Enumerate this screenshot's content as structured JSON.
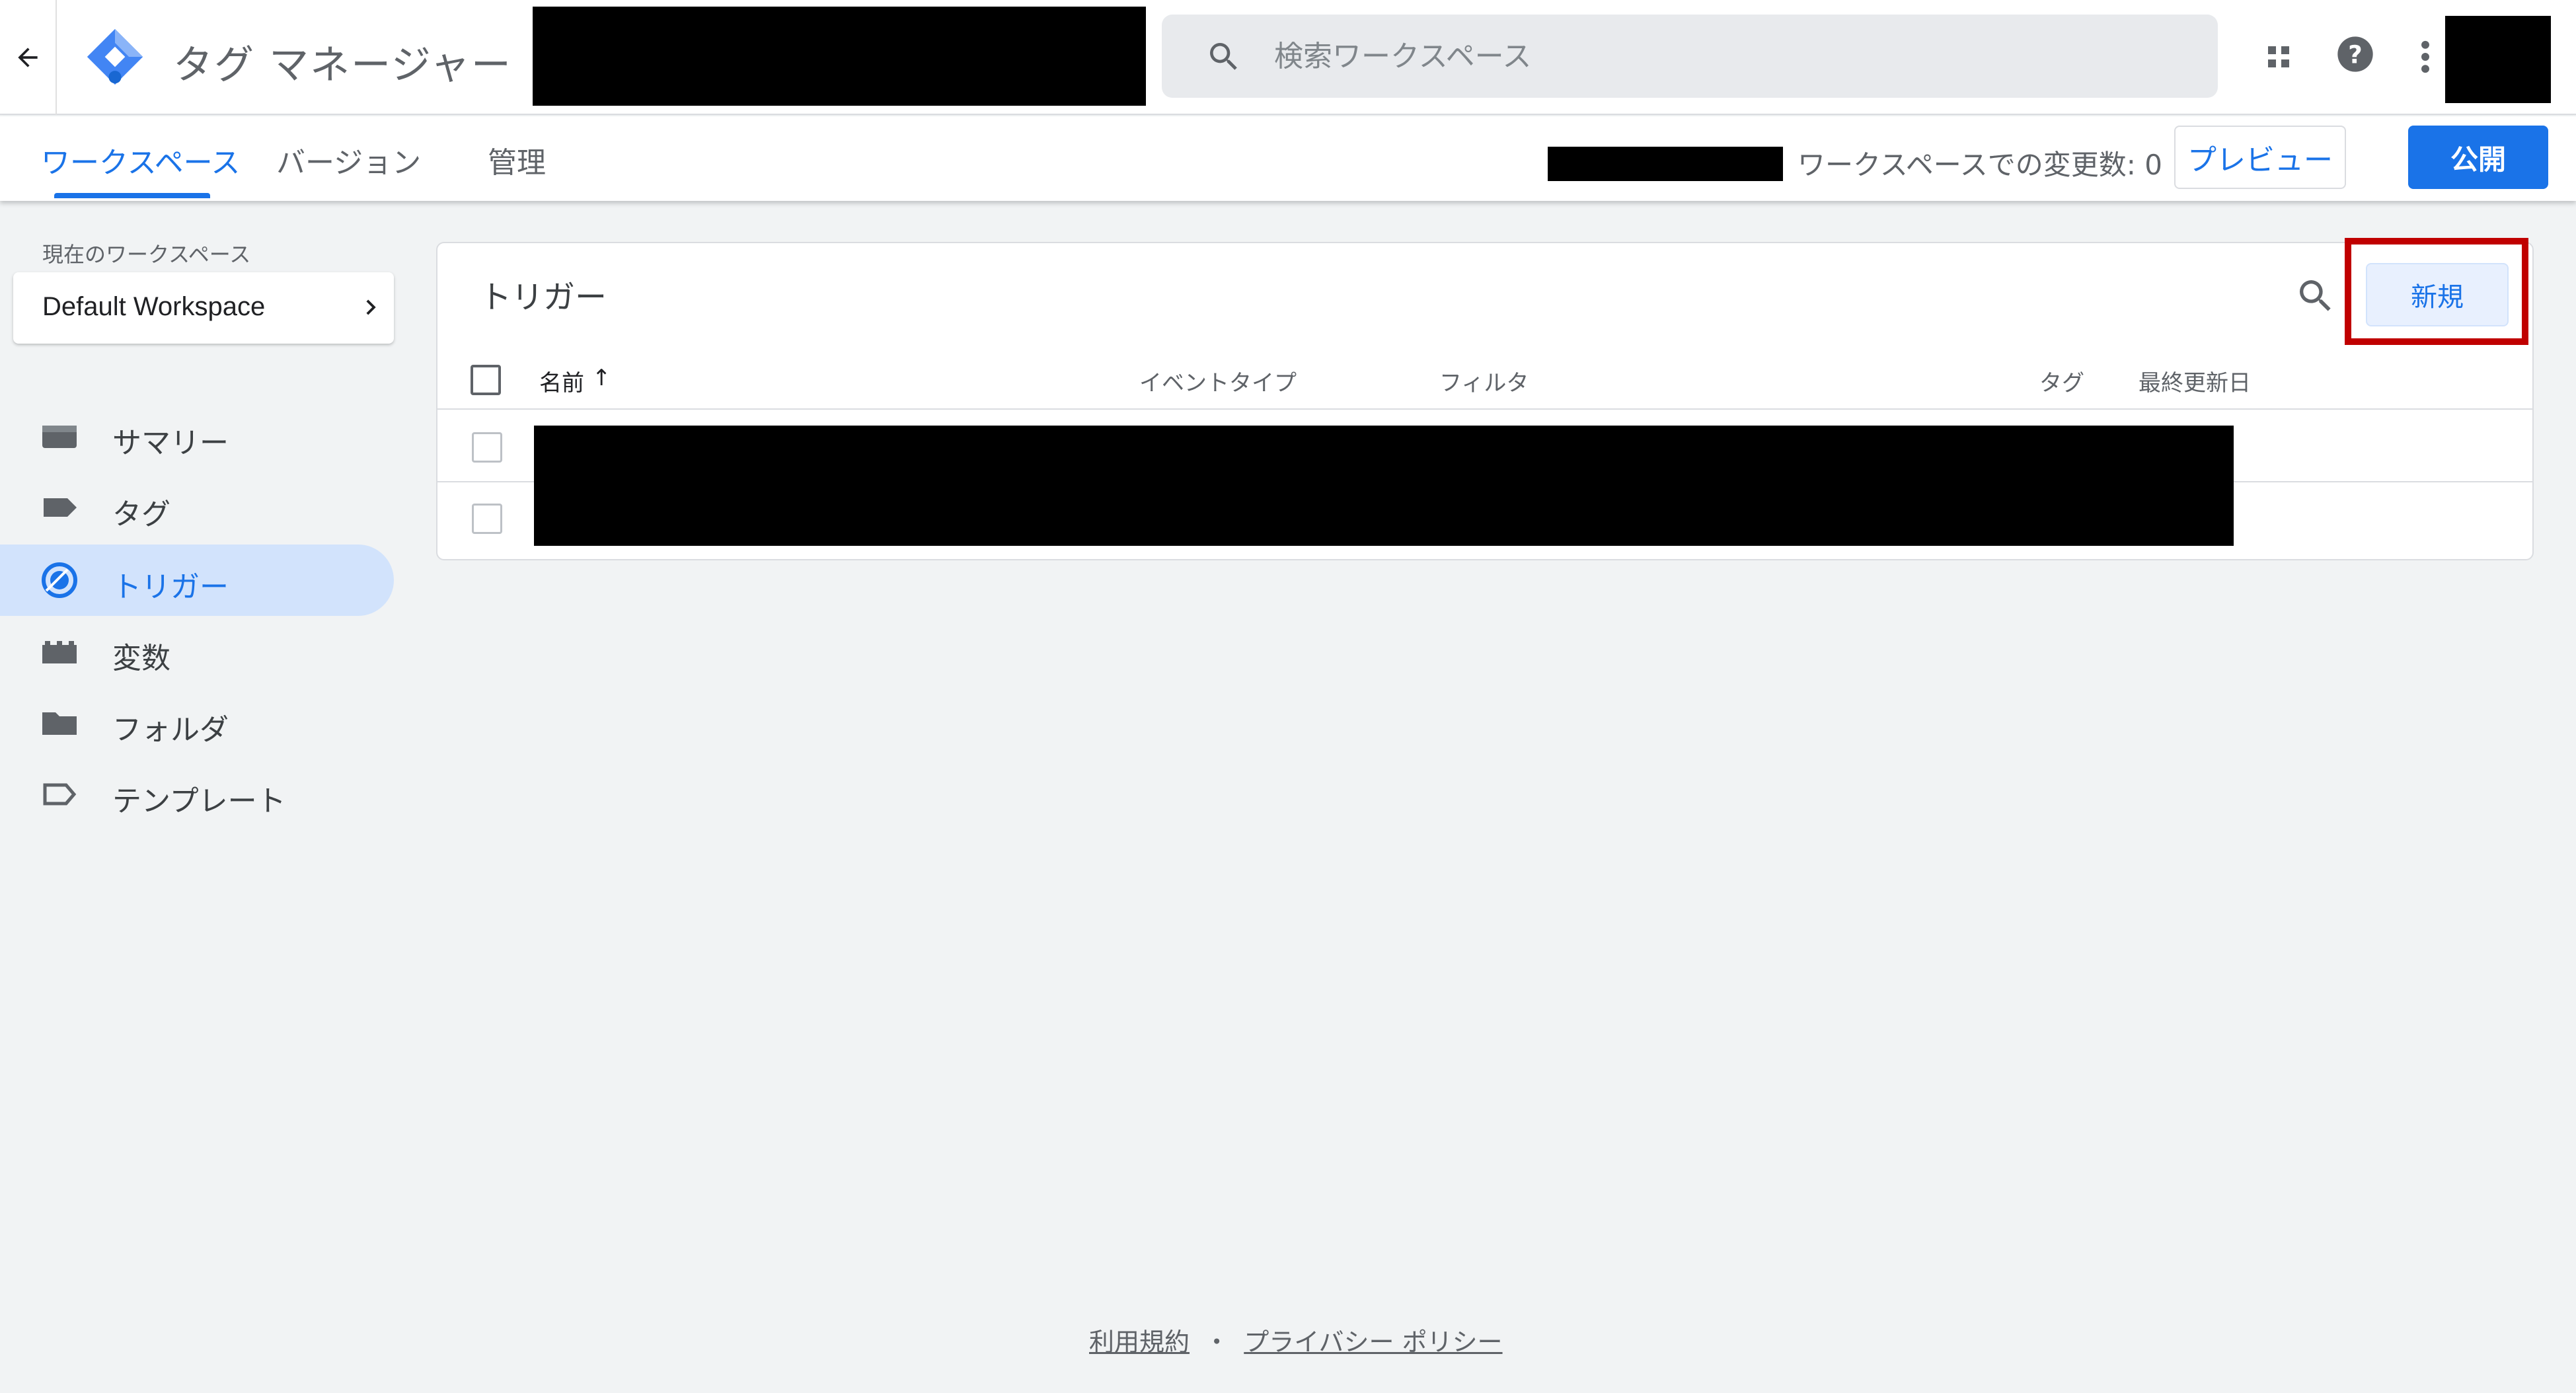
{
  "app": {
    "title": "タグ マネージャー",
    "accent_color": "#1a73e8",
    "logo_icon": "gtm-diamond-logo"
  },
  "header": {
    "search_placeholder": "検索ワークスペース",
    "icons": [
      "back-arrow-icon",
      "apps-grid-icon",
      "help-icon",
      "more-vert-icon"
    ]
  },
  "subnav": {
    "tabs": [
      {
        "label": "ワークスペース",
        "active": true
      },
      {
        "label": "バージョン",
        "active": false
      },
      {
        "label": "管理",
        "active": false
      }
    ],
    "changes_label": "ワークスペースでの変更数: 0",
    "preview_label": "プレビュー",
    "publish_label": "公開"
  },
  "sidebar": {
    "workspace_caption": "現在のワークスペース",
    "workspace_name": "Default Workspace",
    "items": [
      {
        "label": "サマリー",
        "icon": "summary-icon",
        "active": false
      },
      {
        "label": "タグ",
        "icon": "tag-icon",
        "active": false
      },
      {
        "label": "トリガー",
        "icon": "trigger-icon",
        "active": true
      },
      {
        "label": "変数",
        "icon": "variables-icon",
        "active": false
      },
      {
        "label": "フォルダ",
        "icon": "folder-icon",
        "active": false
      },
      {
        "label": "テンプレート",
        "icon": "template-icon",
        "active": false
      }
    ]
  },
  "main": {
    "title": "トリガー",
    "new_button_label": "新規",
    "highlight_color": "#c00000",
    "columns": [
      "名前",
      "イベントタイプ",
      "フィルタ",
      "タグ",
      "最終更新日"
    ],
    "sort_indicator": "↑"
  },
  "footer": {
    "terms_label": "利用規約",
    "separator": "・",
    "privacy_label": "プライバシー ポリシー"
  }
}
